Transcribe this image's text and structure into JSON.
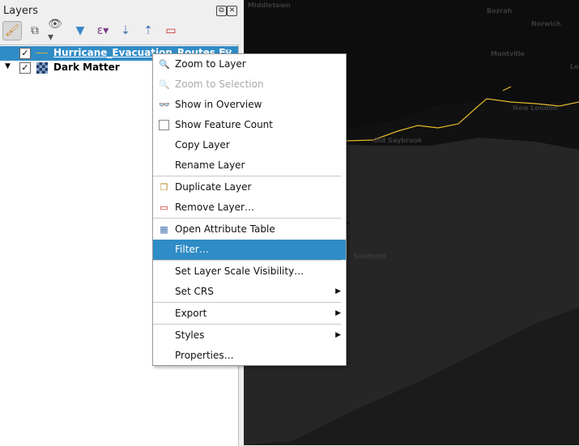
{
  "panel": {
    "title": "Layers"
  },
  "layers": [
    {
      "name": "Hurricane_Evacuation_Routes Ev",
      "checked": true,
      "selected": true
    },
    {
      "name": "Dark Matter",
      "checked": true,
      "selected": false
    }
  ],
  "menu": {
    "items": [
      {
        "label": "Zoom to Layer",
        "icon": "zoom-icon"
      },
      {
        "label": "Zoom to Selection",
        "icon": "zoom-icon",
        "disabled": true
      },
      {
        "label": "Show in Overview",
        "icon": "glasses-icon"
      },
      {
        "label": "Show Feature Count",
        "icon": "checkbox-icon"
      },
      {
        "label": "Copy Layer"
      },
      {
        "label": "Rename Layer"
      },
      {
        "label": "Duplicate Layer",
        "icon": "duplicate-icon"
      },
      {
        "label": "Remove Layer…",
        "icon": "remove-icon"
      },
      {
        "label": "Open Attribute Table",
        "icon": "table-icon"
      },
      {
        "label": "Filter…",
        "highlighted": true
      },
      {
        "label": "Set Layer Scale Visibility…"
      },
      {
        "label": "Set CRS",
        "submenu": true
      },
      {
        "label": "Export",
        "submenu": true
      },
      {
        "label": "Styles",
        "submenu": true
      },
      {
        "label": "Properties…"
      }
    ]
  },
  "map": {
    "labels": [
      "Middletown",
      "Bozrah",
      "Norwich",
      "Montville",
      "Ledyard",
      "New London",
      "Old Saybrook",
      "Southold"
    ],
    "route_color": "#e5b92a"
  }
}
